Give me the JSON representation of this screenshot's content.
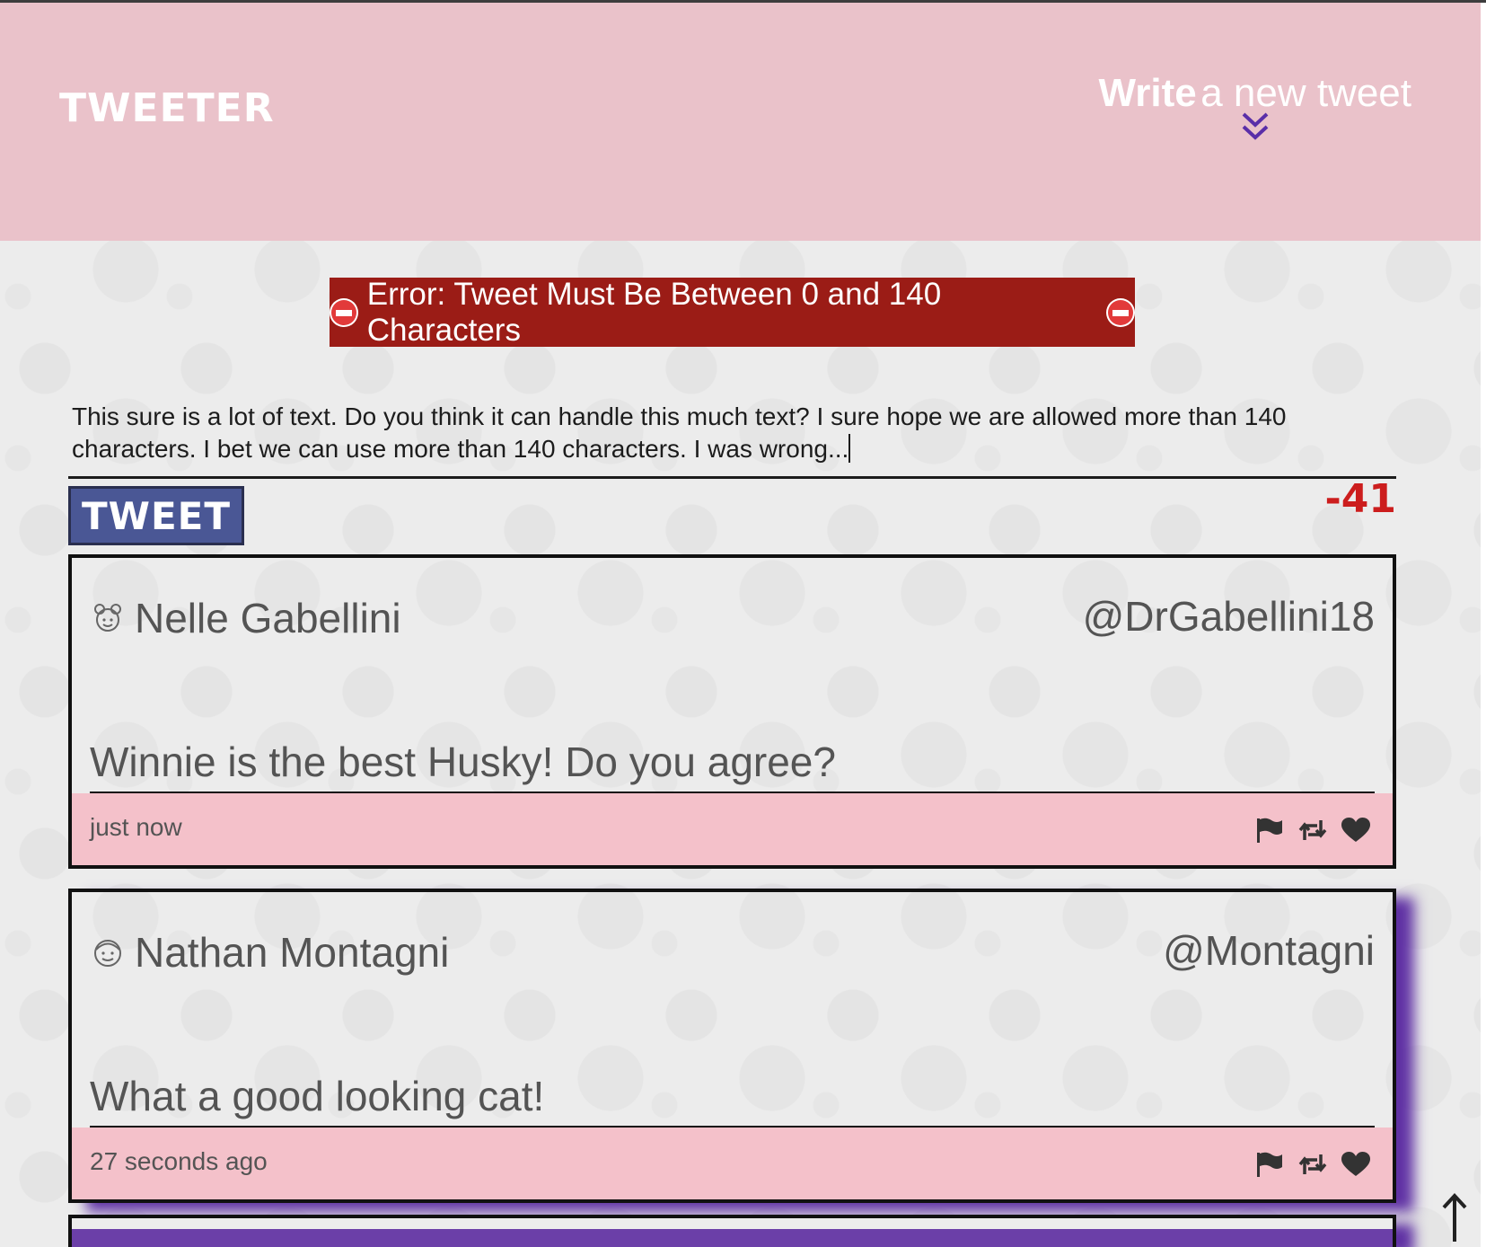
{
  "nav": {
    "brand": "TWEETER",
    "compose_toggle": {
      "bold_word": "Write",
      "rest_text": "a new tweet",
      "icon": "chevron-double-down-icon"
    }
  },
  "error": {
    "message": "Error: Tweet Must Be Between 0 and 140 Characters",
    "icon": "no-entry-icon"
  },
  "composer": {
    "text": "This sure is a lot of text. Do you think it can handle this much text? I sure hope we are allowed more than 140 characters. I bet we can use more than 140 characters. I was wrong...",
    "submit_label": "TWEET",
    "counter": "-41"
  },
  "tweets": [
    {
      "name": "Nelle Gabellini",
      "handle": "@DrGabellini18",
      "content": "Winnie is the best Husky! Do you agree?",
      "time": "just now",
      "avatar_icon": "girl-avatar-icon"
    },
    {
      "name": "Nathan Montagni",
      "handle": "@Montagni",
      "content": "What a good looking cat!",
      "time": "27 seconds ago",
      "avatar_icon": "boy-avatar-icon"
    }
  ],
  "colors": {
    "nav_bg": "#eac2ca",
    "error_bg": "#9b1c16",
    "tweet_button_bg": "#4a5795",
    "counter_color": "#cc1d1d",
    "tweet_footer_bg": "#f4c1ca",
    "hover_shadow": "#5828a0",
    "chevron": "#5a2ea8"
  },
  "icons": {
    "flag": "flag-icon",
    "retweet": "retweet-icon",
    "like": "heart-icon",
    "scroll_top": "arrow-up-icon"
  }
}
